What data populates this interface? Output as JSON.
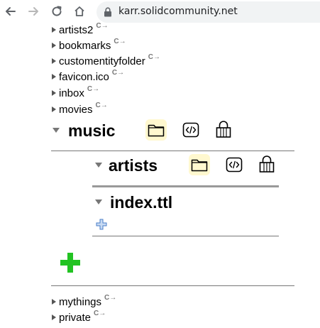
{
  "browser": {
    "url": "karr.solidcommunity.net"
  },
  "tree": {
    "top_items": [
      {
        "label": "artists2"
      },
      {
        "label": "bookmarks"
      },
      {
        "label": "customentityfolder"
      },
      {
        "label": "favicon.ico"
      },
      {
        "label": "inbox"
      },
      {
        "label": "movies"
      }
    ],
    "music": {
      "label": "music"
    },
    "artists": {
      "label": "artists"
    },
    "index": {
      "label": "index.ttl"
    },
    "bottom_items": [
      {
        "label": "mythings"
      },
      {
        "label": "private"
      }
    ]
  },
  "colors": {
    "folder_highlight": "#fff8cf",
    "add_green": "#22c322",
    "small_plus_blue": "#4a7dc8"
  },
  "icons": [
    "back-arrow-icon",
    "forward-arrow-icon",
    "reload-icon",
    "home-icon",
    "lock-icon",
    "folder-icon",
    "code-icon",
    "padlock-icon",
    "plus-icon",
    "external-link-icon"
  ]
}
